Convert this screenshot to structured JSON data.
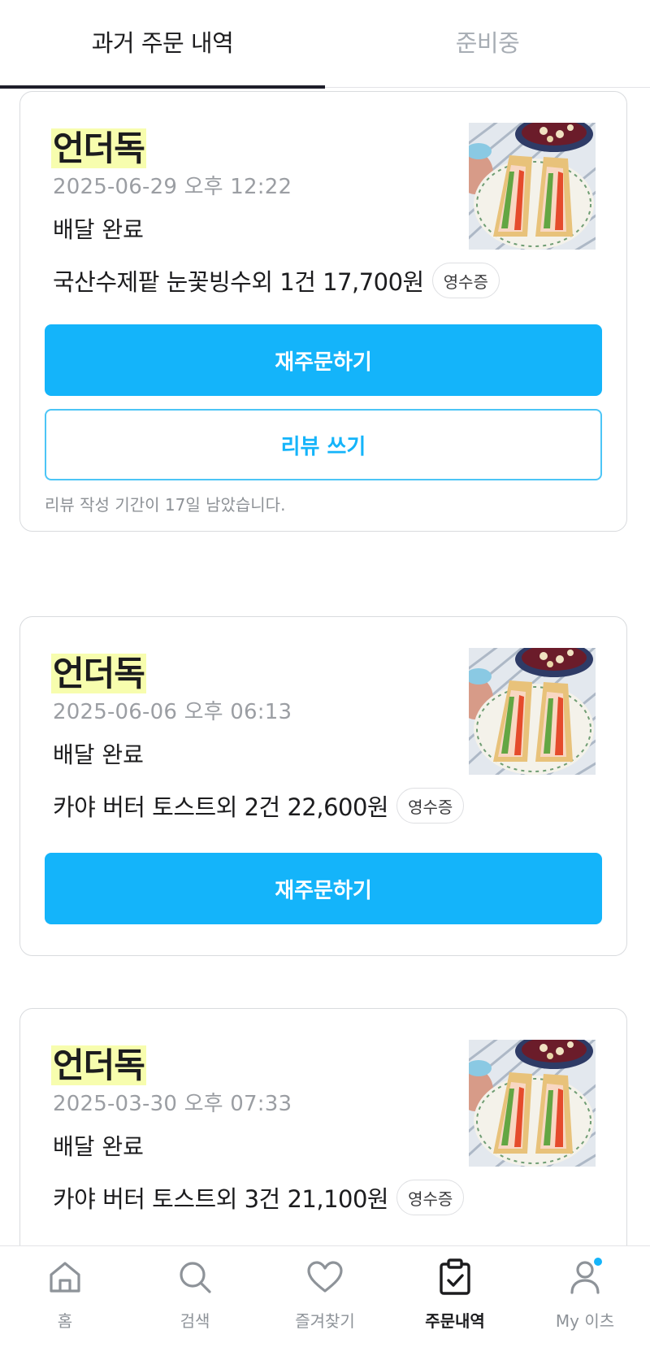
{
  "tabs": [
    {
      "label": "과거 주문 내역",
      "active": true
    },
    {
      "label": "준비중",
      "active": false
    }
  ],
  "orders": [
    {
      "store": "언더독",
      "date": "2025-06-29 오후 12:22",
      "status": "배달 완료",
      "summary": "국산수제팥 눈꽃빙수외 1건 17,700원",
      "receipt_label": "영수증",
      "reorder_label": "재주문하기",
      "review_label": "리뷰 쓰기",
      "review_hint": "리뷰 작성 기간이 17일 남았습니다."
    },
    {
      "store": "언더독",
      "date": "2025-06-06 오후 06:13",
      "status": "배달 완료",
      "summary": "카야 버터 토스트외 2건 22,600원",
      "receipt_label": "영수증",
      "reorder_label": "재주문하기"
    },
    {
      "store": "언더독",
      "date": "2025-03-30 오후 07:33",
      "status": "배달 완료",
      "summary": "카야 버터 토스트외 3건 21,100원",
      "receipt_label": "영수증"
    }
  ],
  "bottom_nav": [
    {
      "label": "홈",
      "icon": "home-icon",
      "active": false
    },
    {
      "label": "검색",
      "icon": "search-icon",
      "active": false
    },
    {
      "label": "즐겨찾기",
      "icon": "heart-icon",
      "active": false
    },
    {
      "label": "주문내역",
      "icon": "clipboard-check-icon",
      "active": true
    },
    {
      "label": "My 이츠",
      "icon": "user-icon",
      "active": false,
      "has_notification_dot": true
    }
  ],
  "colors": {
    "accent": "#14b4fa",
    "highlight": "#f7fdae",
    "muted_text": "#9b9ea3"
  }
}
